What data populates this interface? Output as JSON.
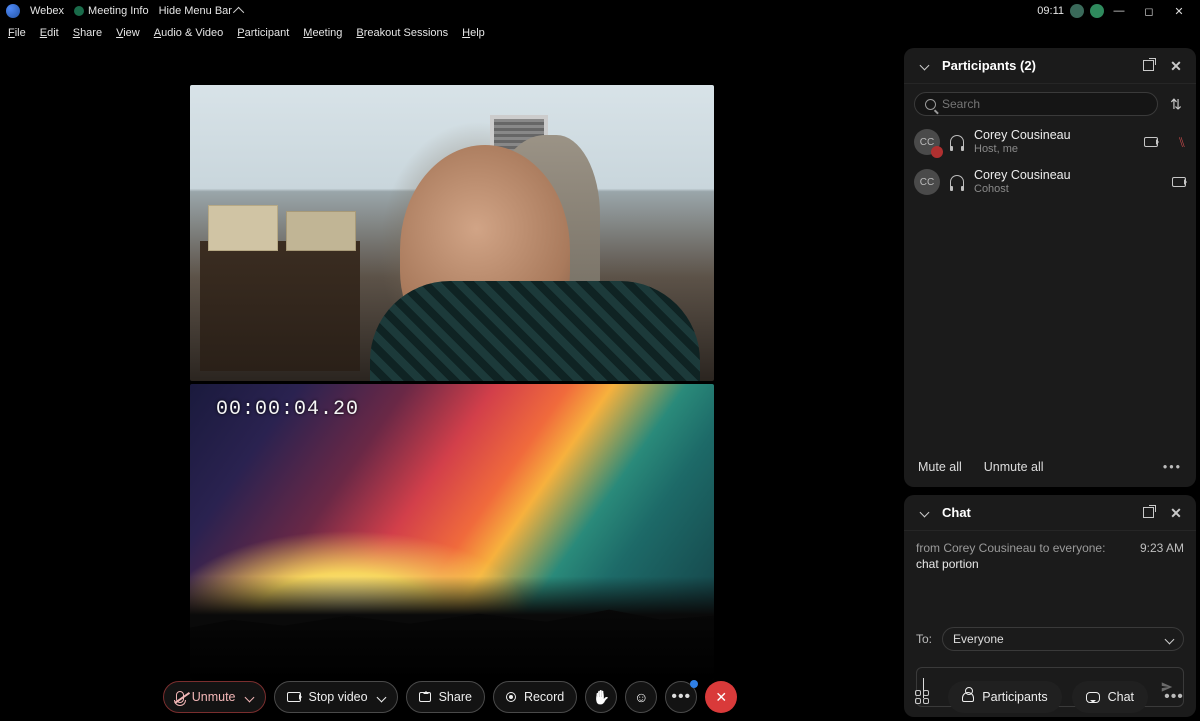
{
  "titlebar": {
    "app": "Webex",
    "meeting_info": "Meeting Info",
    "hide_menu": "Hide Menu Bar",
    "clock": "09:11"
  },
  "menubar": [
    "File",
    "Edit",
    "Share",
    "View",
    "Audio & Video",
    "Participant",
    "Meeting",
    "Breakout Sessions",
    "Help"
  ],
  "video": {
    "tile2_timecode": "00:00:04.20"
  },
  "participants": {
    "title": "Participants (2)",
    "search_placeholder": "Search",
    "list": [
      {
        "initials": "CC",
        "name": "Corey Cousineau",
        "role": "Host, me",
        "muted": true,
        "camera": true
      },
      {
        "initials": "CC",
        "name": "Corey Cousineau",
        "role": "Cohost",
        "muted": false,
        "camera": true
      }
    ],
    "mute_all": "Mute all",
    "unmute_all": "Unmute all"
  },
  "chat": {
    "title": "Chat",
    "from_line": "from Corey Cousineau to everyone:",
    "from_time": "9:23 AM",
    "message": "chat portion",
    "to_label": "To:",
    "to_value": "Everyone"
  },
  "toolbar": {
    "unmute": "Unmute",
    "stop_video": "Stop video",
    "share": "Share",
    "record": "Record"
  },
  "bottom_right": {
    "participants": "Participants",
    "chat": "Chat"
  }
}
